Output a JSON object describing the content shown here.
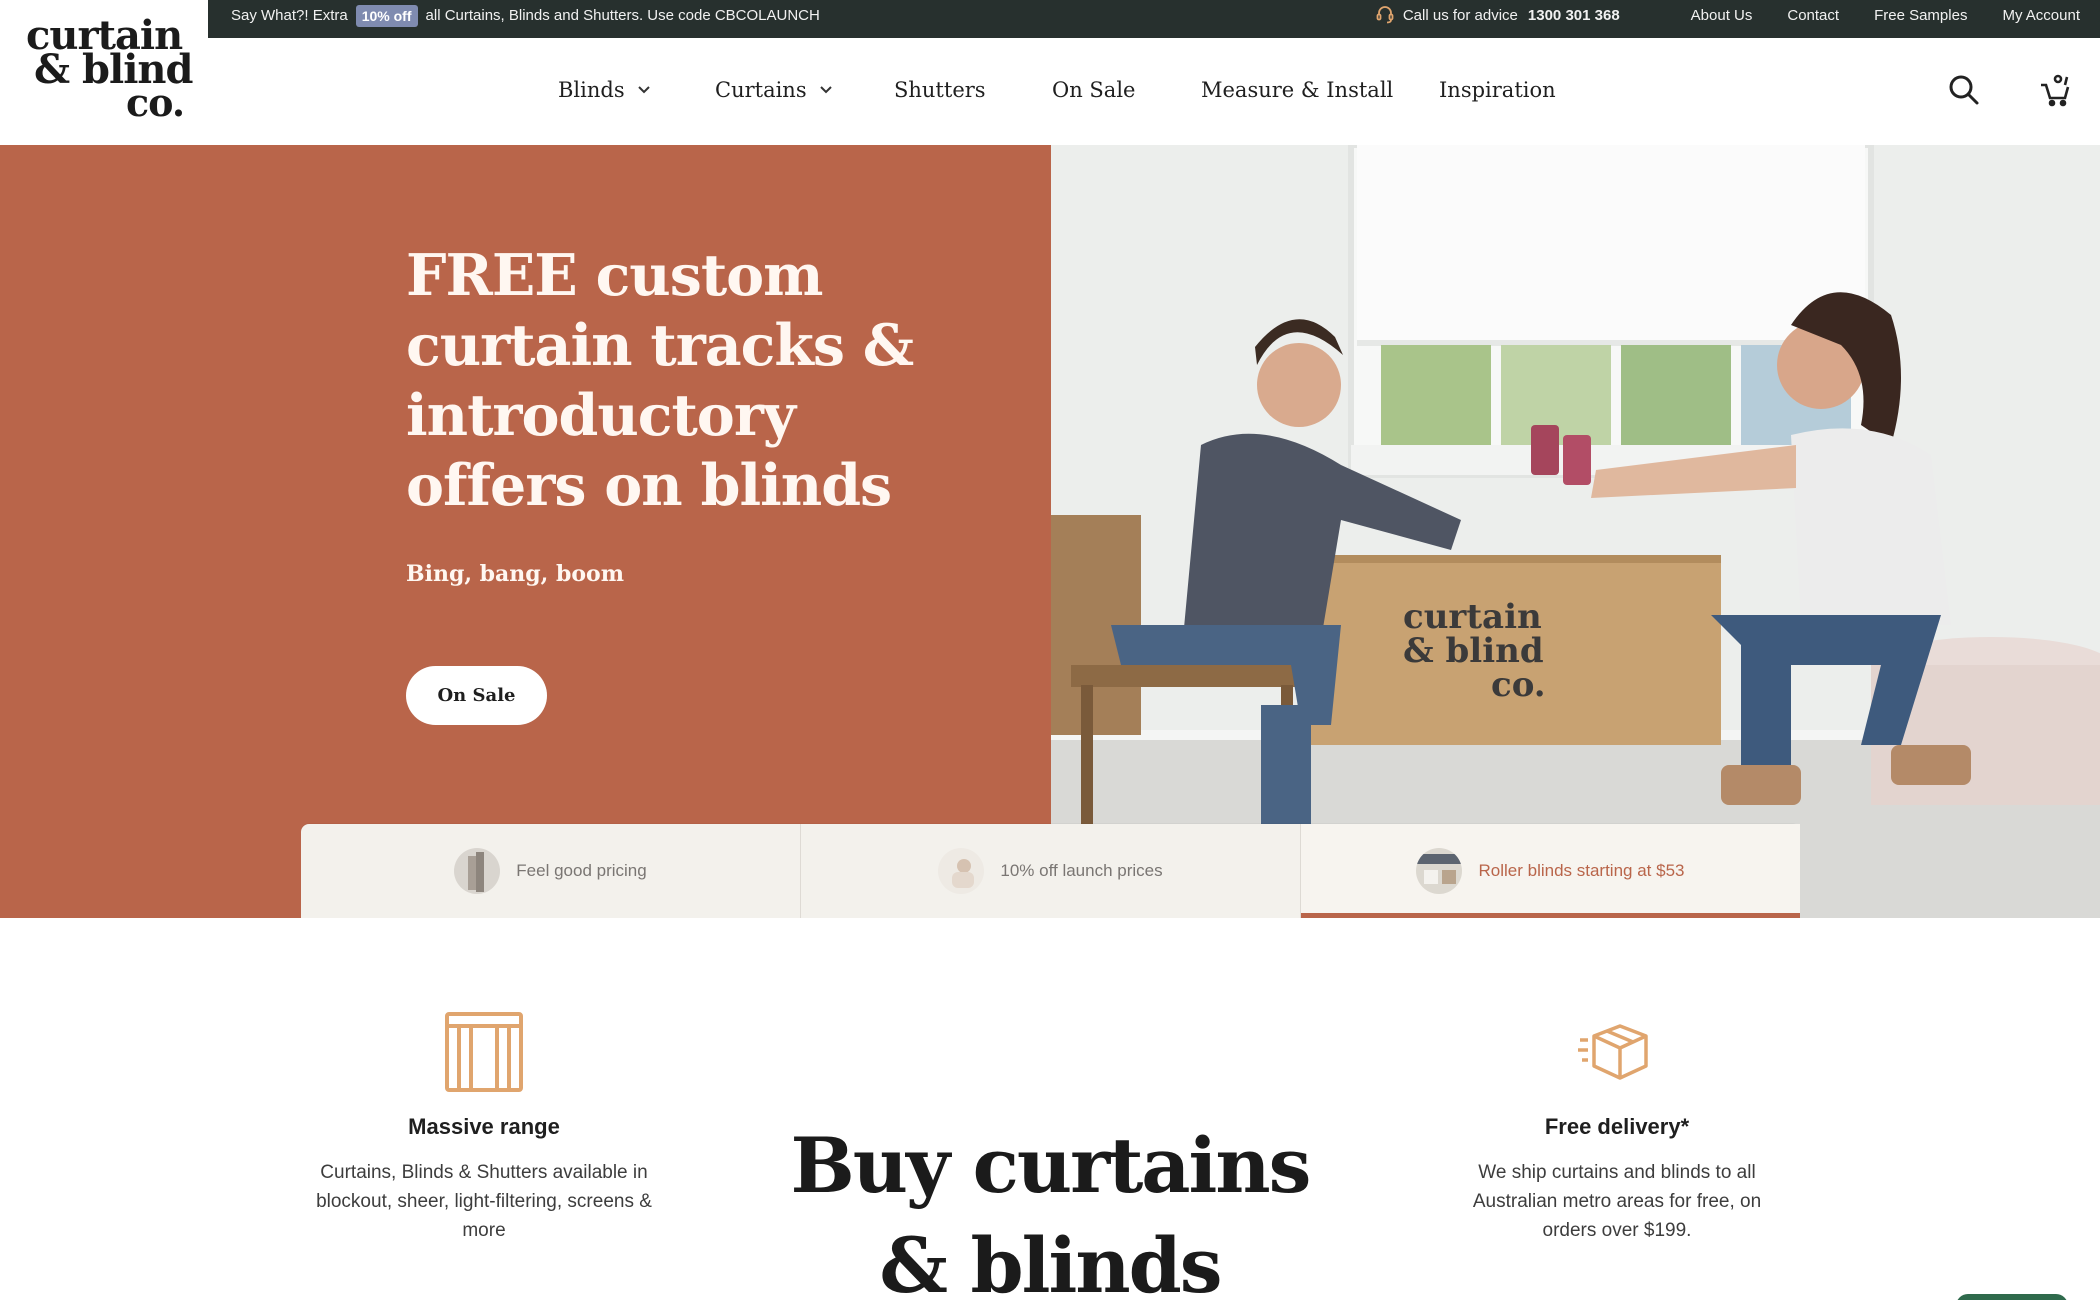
{
  "brand": {
    "logo_line1": "curtain",
    "logo_line2": "& blind",
    "logo_line3": "co."
  },
  "topbar": {
    "promo_prefix": "Say What?! Extra",
    "promo_badge": "10% off",
    "promo_text": "all Curtains, Blinds and Shutters. Use code CBCOLAUNCH",
    "advice_label": "Call us for advice",
    "phone": "1300 301 368",
    "links": [
      "About Us",
      "Contact",
      "Free Samples",
      "My Account"
    ]
  },
  "nav": {
    "items": [
      "Blinds",
      "Curtains",
      "Shutters",
      "On Sale",
      "Measure & Install",
      "Inspiration"
    ]
  },
  "hero": {
    "title": "FREE custom curtain tracks & introductory offers on blinds",
    "subtitle": "Bing, bang, boom",
    "button_label": "On Sale",
    "box_line1": "curtain",
    "box_line2": "& blind",
    "box_line3": "co."
  },
  "tabs": [
    {
      "label": "Feel good pricing",
      "active": false
    },
    {
      "label": "10% off launch prices",
      "active": false
    },
    {
      "label": "Roller blinds starting at $53",
      "active": true
    }
  ],
  "features": {
    "left": {
      "icon": "window-frame-icon",
      "title": "Massive range",
      "text": "Curtains, Blinds & Shutters available in blockout, sheer, light-filtering, screens & more"
    },
    "center_title": "Buy curtains & blinds",
    "right": {
      "icon": "delivery-box-icon",
      "title": "Free delivery*",
      "text": "We ship curtains and blinds to all Australian metro areas for free, on orders over $199."
    }
  },
  "colors": {
    "accent": "#b9654a",
    "topbar_bg": "#27302e",
    "icon_tan": "#e0a56e",
    "tab_bg": "#f3f1ec"
  }
}
